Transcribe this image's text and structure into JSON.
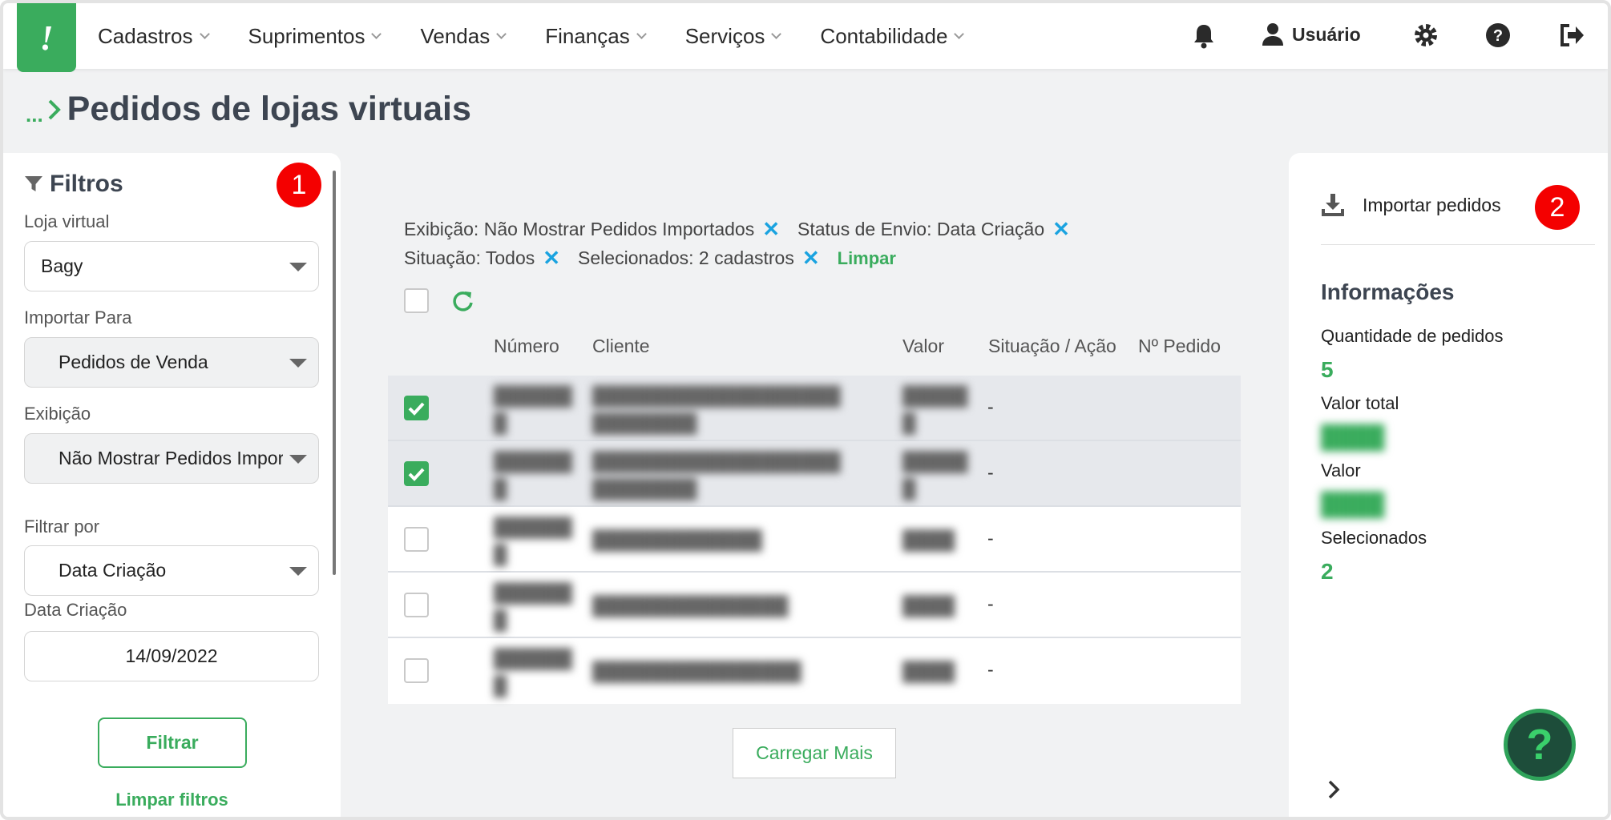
{
  "app": {
    "logo_text": "!"
  },
  "menu": [
    {
      "label": "Cadastros"
    },
    {
      "label": "Suprimentos"
    },
    {
      "label": "Vendas"
    },
    {
      "label": "Finanças"
    },
    {
      "label": "Serviços"
    },
    {
      "label": "Contabilidade"
    }
  ],
  "user": {
    "name": "Usuário"
  },
  "breadcrumb": {
    "dots": "...",
    "title": "Pedidos de lojas virtuais"
  },
  "filters": {
    "title": "Filtros",
    "badge": "1",
    "loja_label": "Loja virtual",
    "loja_value": "Bagy",
    "importar_label": "Importar Para",
    "importar_value": "Pedidos de Venda",
    "exibicao_label": "Exibição",
    "exibicao_value": "Não Mostrar Pedidos Importados",
    "filtrar_por_label": "Filtrar por",
    "filtrar_por_value": "Data Criação",
    "data_label": "Data Criação",
    "data_value": "14/09/2022",
    "filter_button": "Filtrar",
    "clear_button": "Limpar filtros"
  },
  "chips": [
    {
      "label": "Exibição: Não Mostrar Pedidos Importados"
    },
    {
      "label": "Status de Envio: Data Criação"
    },
    {
      "label": "Situação: Todos"
    },
    {
      "label": "Selecionados: 2 cadastros"
    }
  ],
  "chips_clear": "Limpar",
  "table": {
    "headers": {
      "numero": "Número",
      "cliente": "Cliente",
      "valor": "Valor",
      "situacao": "Situação / Ação",
      "pedido": "Nº Pedido"
    },
    "rows": [
      {
        "checked": true,
        "situacao": "-"
      },
      {
        "checked": true,
        "situacao": "-"
      },
      {
        "checked": false,
        "situacao": "-"
      },
      {
        "checked": false,
        "situacao": "-"
      },
      {
        "checked": false,
        "situacao": "-"
      }
    ],
    "load_more": "Carregar Mais"
  },
  "panel": {
    "import_label": "Importar pedidos",
    "badge": "2",
    "info_title": "Informações",
    "qtd_label": "Quantidade de pedidos",
    "qtd_value": "5",
    "valor_total_label": "Valor total",
    "valor_label": "Valor",
    "selecionados_label": "Selecionados",
    "selecionados_value": "2"
  },
  "help": {
    "symbol": "?"
  },
  "colors": {
    "brand": "#3aac5d",
    "chip_x": "#1aa3e0",
    "badge": "#f40000",
    "help_bg": "#1d4d3a"
  }
}
